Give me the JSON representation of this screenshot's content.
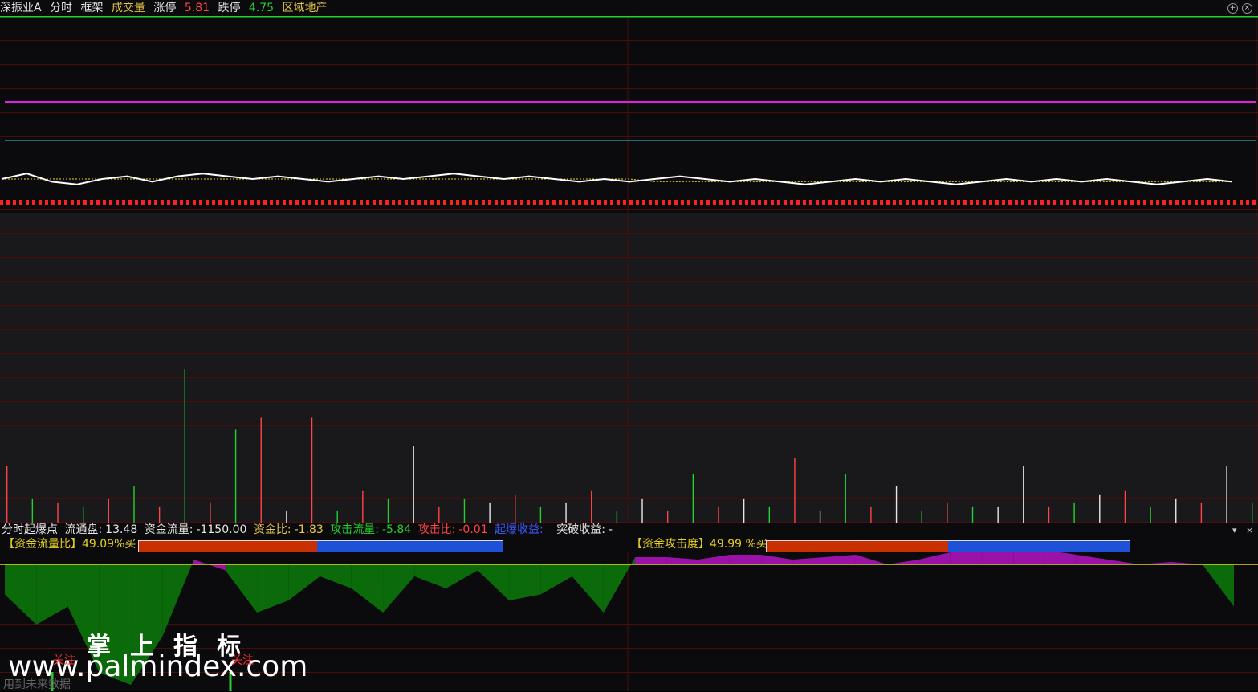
{
  "title_bar": {
    "stock_name": "深振业A",
    "mode": "分时",
    "framework": "框架",
    "volume_label": "成交量",
    "limit_up_label": "涨停",
    "limit_up_value": "5.81",
    "limit_down_label": "跌停",
    "limit_down_value": "4.75",
    "sector": "区域地产"
  },
  "window_controls": {
    "add_icon": "plus-circle-icon",
    "close_icon": "close-circle-icon",
    "add_glyph": "+",
    "close_glyph": "×"
  },
  "indicator_header": {
    "name": "分时起爆点",
    "float_label": "流通盘:",
    "float_value": "13.48",
    "flow_label": "资金流量:",
    "flow_value": "-1150.00",
    "ratio_label": "资金比:",
    "ratio_value": "-1.83",
    "attack_flow_label": "攻击流量:",
    "attack_flow_value": "-5.84",
    "attack_ratio_label": "攻击比:",
    "attack_ratio_value": "-0.01",
    "burst_gain_label": "起爆收益:",
    "breakout_gain_label": "突破收益:",
    "breakout_gain_value": "-"
  },
  "panel_controls": {
    "dropdown_glyph": "▾",
    "close_glyph": "×"
  },
  "flow_ratio": {
    "label": "【资金流量比】",
    "value": "49.09%",
    "suffix": "买",
    "fill_fraction": 0.4909
  },
  "attack_degree": {
    "label": "【资金攻击度】",
    "value": "49.99 %",
    "suffix": "买",
    "fill_fraction": 0.4999
  },
  "signals": [
    "关注",
    "关注"
  ],
  "watermark": {
    "cn": "掌上指标",
    "url": "www.palmindex.com"
  },
  "footnote": "用到未来数据",
  "colors": {
    "up": "#ff4545",
    "down": "#22d12e",
    "neutral": "#e6e6e6",
    "magenta_line": "#e020e0",
    "cyan_line": "#40c8d8",
    "price_line": "#ffffff",
    "avg_line": "#e8d020",
    "bar_red": "#c83000",
    "bar_blue": "#1e50d8",
    "area_green": "#0b6b0b",
    "area_magenta": "#9a12a8"
  },
  "chart_data": {
    "type": "line",
    "price_series": [
      5.29,
      5.31,
      5.28,
      5.27,
      5.29,
      5.3,
      5.28,
      5.3,
      5.31,
      5.3,
      5.29,
      5.3,
      5.29,
      5.28,
      5.29,
      5.3,
      5.29,
      5.3,
      5.31,
      5.3,
      5.29,
      5.3,
      5.29,
      5.28,
      5.29,
      5.28,
      5.29,
      5.3,
      5.29,
      5.28,
      5.29,
      5.28,
      5.27,
      5.28,
      5.29,
      5.28,
      5.29,
      5.28,
      5.27,
      5.28,
      5.29,
      5.28,
      5.29,
      5.28,
      5.29,
      5.28,
      5.27,
      5.28,
      5.29,
      5.28
    ],
    "avg_series": [
      5.29,
      5.29,
      5.29,
      5.29,
      5.29,
      5.29,
      5.29,
      5.29,
      5.29,
      5.29,
      5.29,
      5.29,
      5.29,
      5.29,
      5.29,
      5.29,
      5.29,
      5.29,
      5.29,
      5.29,
      5.29,
      5.29,
      5.29,
      5.29,
      5.29,
      5.29,
      5.28,
      5.28,
      5.28,
      5.28,
      5.28,
      5.28,
      5.28,
      5.28,
      5.28,
      5.28,
      5.28,
      5.28,
      5.28,
      5.28,
      5.28,
      5.28,
      5.28,
      5.28,
      5.28,
      5.28,
      5.28,
      5.28,
      5.28,
      5.28
    ],
    "volume_series": [
      {
        "v": 70,
        "c": "up"
      },
      {
        "v": 30,
        "c": "down"
      },
      {
        "v": 25,
        "c": "up"
      },
      {
        "v": 20,
        "c": "down"
      },
      {
        "v": 30,
        "c": "up"
      },
      {
        "v": 45,
        "c": "down"
      },
      {
        "v": 20,
        "c": "up"
      },
      {
        "v": 190,
        "c": "down"
      },
      {
        "v": 25,
        "c": "up"
      },
      {
        "v": 115,
        "c": "down"
      },
      {
        "v": 130,
        "c": "up"
      },
      {
        "v": 15,
        "c": "neutral"
      },
      {
        "v": 130,
        "c": "up"
      },
      {
        "v": 15,
        "c": "down"
      },
      {
        "v": 40,
        "c": "up"
      },
      {
        "v": 30,
        "c": "down"
      },
      {
        "v": 95,
        "c": "neutral"
      },
      {
        "v": 20,
        "c": "up"
      },
      {
        "v": 30,
        "c": "down"
      },
      {
        "v": 25,
        "c": "neutral"
      },
      {
        "v": 35,
        "c": "up"
      },
      {
        "v": 20,
        "c": "down"
      },
      {
        "v": 25,
        "c": "neutral"
      },
      {
        "v": 40,
        "c": "up"
      },
      {
        "v": 15,
        "c": "down"
      },
      {
        "v": 30,
        "c": "neutral"
      },
      {
        "v": 15,
        "c": "up"
      },
      {
        "v": 60,
        "c": "down"
      },
      {
        "v": 20,
        "c": "up"
      },
      {
        "v": 30,
        "c": "neutral"
      },
      {
        "v": 20,
        "c": "down"
      },
      {
        "v": 80,
        "c": "up"
      },
      {
        "v": 15,
        "c": "neutral"
      },
      {
        "v": 60,
        "c": "down"
      },
      {
        "v": 20,
        "c": "up"
      },
      {
        "v": 45,
        "c": "neutral"
      },
      {
        "v": 15,
        "c": "down"
      },
      {
        "v": 25,
        "c": "up"
      },
      {
        "v": 20,
        "c": "down"
      },
      {
        "v": 20,
        "c": "neutral"
      },
      {
        "v": 70,
        "c": "neutral"
      },
      {
        "v": 20,
        "c": "up"
      },
      {
        "v": 25,
        "c": "down"
      },
      {
        "v": 35,
        "c": "neutral"
      },
      {
        "v": 40,
        "c": "up"
      },
      {
        "v": 20,
        "c": "down"
      },
      {
        "v": 30,
        "c": "neutral"
      },
      {
        "v": 25,
        "c": "up"
      },
      {
        "v": 70,
        "c": "neutral"
      },
      {
        "v": 25,
        "c": "down"
      }
    ],
    "volume_max": 190,
    "flow_area": [
      -0.25,
      -0.5,
      -0.35,
      -0.9,
      -1.0,
      -0.6,
      0.1,
      -0.05,
      -0.4,
      -0.3,
      -0.1,
      -0.2,
      -0.4,
      -0.1,
      -0.2,
      -0.05,
      -0.3,
      -0.25,
      -0.1,
      -0.4,
      0.15,
      0.15,
      0.1,
      0.2,
      0.2,
      0.1,
      0.15,
      0.2,
      0.0,
      0.1,
      0.25,
      0.25,
      0.3,
      0.3,
      0.2,
      0.1,
      0.0,
      0.05,
      0.0,
      -0.35
    ],
    "ylim": [
      5.0,
      5.6
    ]
  }
}
